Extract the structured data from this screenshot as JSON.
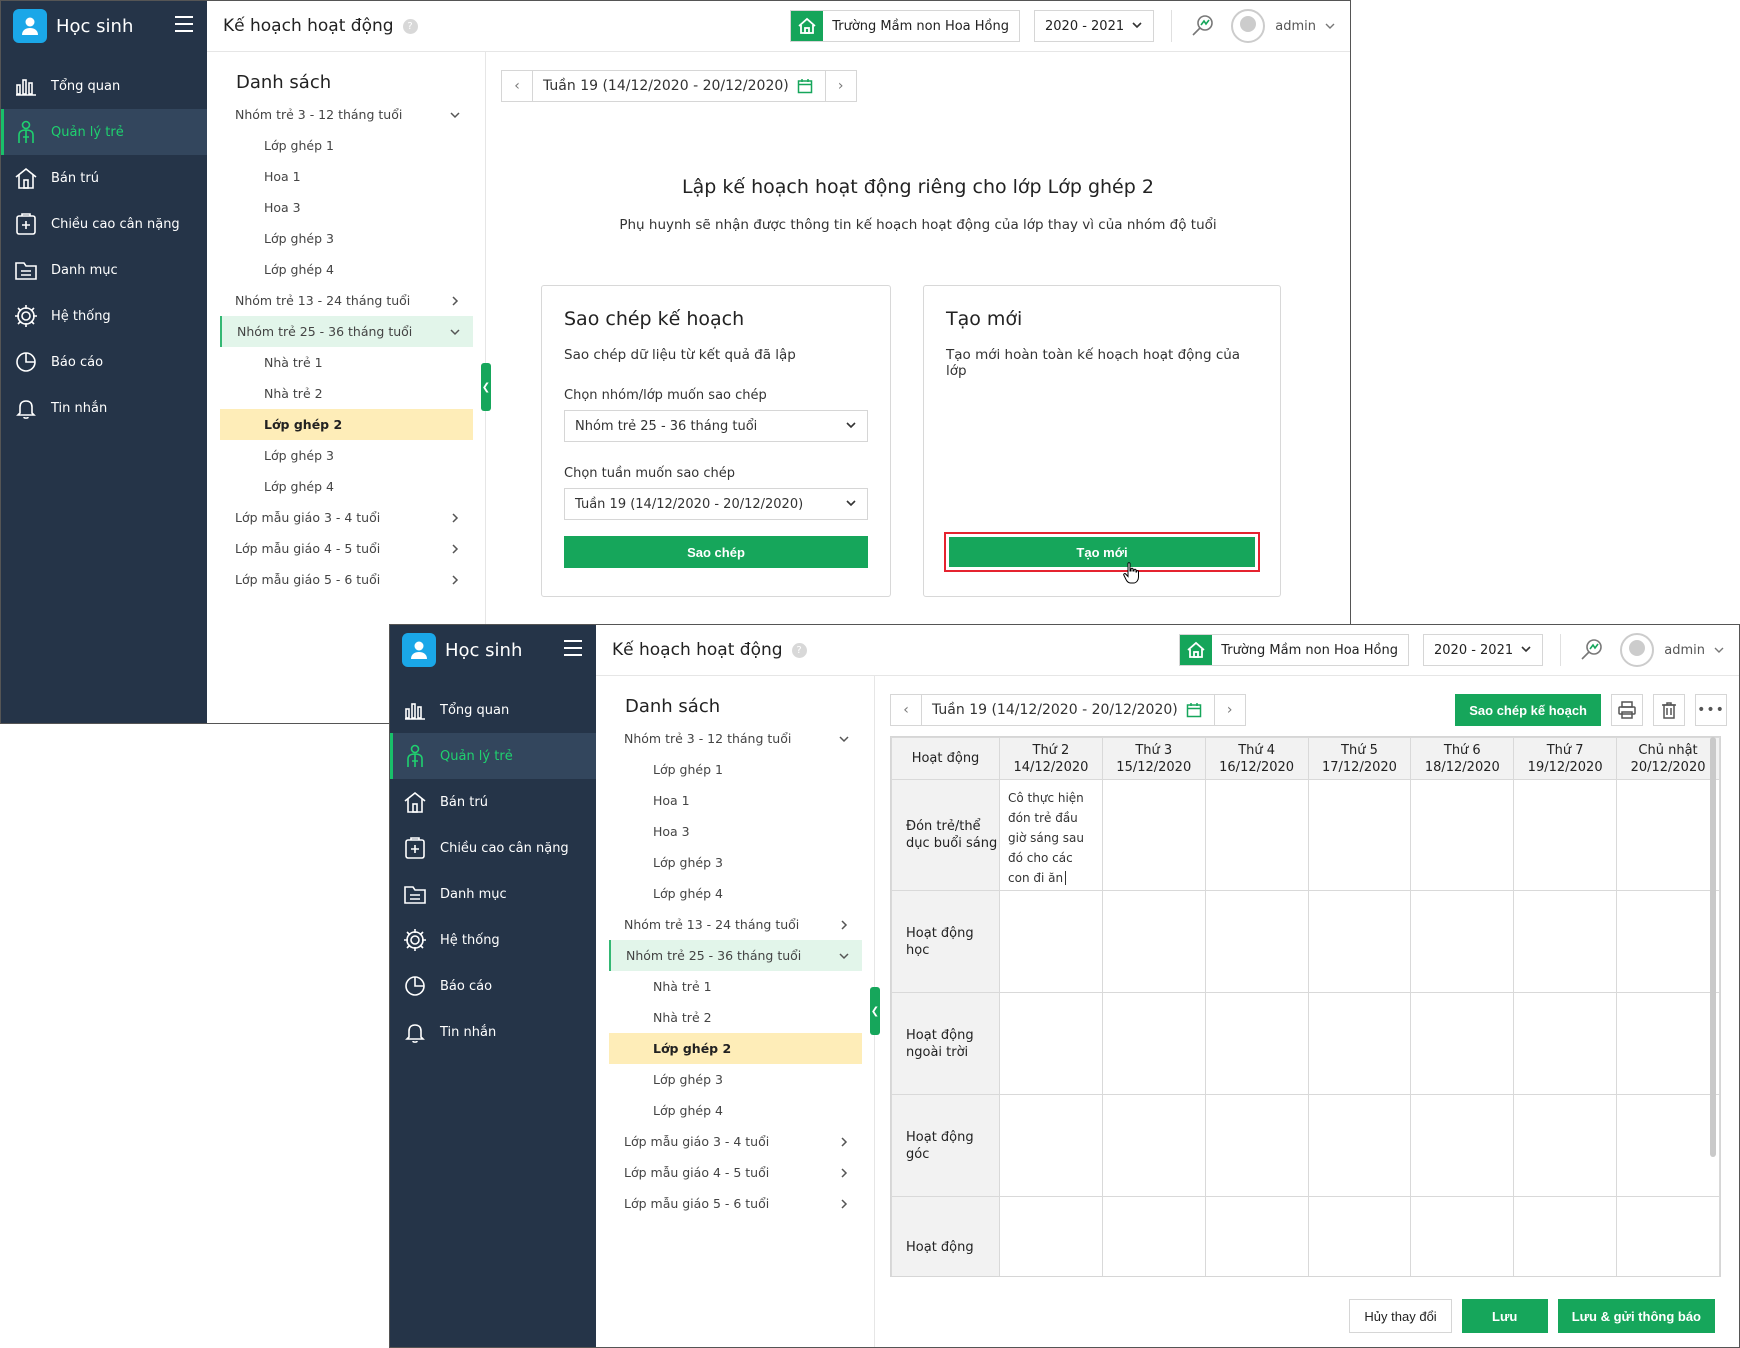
{
  "app": {
    "title": "Học sinh"
  },
  "nav": [
    "Tổng quan",
    "Quản lý trẻ",
    "Bán trú",
    "Chiều cao cân nặng",
    "Danh mục",
    "Hệ thống",
    "Báo cáo",
    "Tin nhắn"
  ],
  "nav_active": "Quản lý trẻ",
  "header": {
    "title": "Kế hoạch hoạt động",
    "help": "?",
    "school": "Trường Mầm non Hoa Hồng",
    "year": "2020 - 2021",
    "user": "admin"
  },
  "list": {
    "title": "Danh sách",
    "items": [
      {
        "label": "Nhóm trẻ 3 - 12 tháng tuổi",
        "level": 0,
        "expanded": true
      },
      {
        "label": "Lớp ghép 1",
        "level": 1
      },
      {
        "label": "Hoa 1",
        "level": 1
      },
      {
        "label": "Hoa 3",
        "level": 1
      },
      {
        "label": "Lớp ghép 3",
        "level": 1
      },
      {
        "label": "Lớp ghép 4",
        "level": 1
      },
      {
        "label": "Nhóm trẻ 13 - 24 tháng tuổi",
        "level": 0,
        "expanded": false
      },
      {
        "label": "Nhóm trẻ 25 - 36 tháng tuổi",
        "level": 0,
        "expanded": true,
        "selected": true
      },
      {
        "label": "Nhà trẻ 1",
        "level": 1
      },
      {
        "label": "Nhà trẻ 2",
        "level": 1
      },
      {
        "label": "Lớp ghép 2",
        "level": 1,
        "selected": true
      },
      {
        "label": "Lớp ghép 3",
        "level": 1
      },
      {
        "label": "Lớp ghép 4",
        "level": 1
      },
      {
        "label": "Lớp mẫu giáo 3 - 4 tuổi",
        "level": 0,
        "expanded": false
      },
      {
        "label": "Lớp mẫu giáo 4 - 5 tuổi",
        "level": 0,
        "expanded": false
      },
      {
        "label": "Lớp mẫu giáo 5 - 6 tuổi",
        "level": 0,
        "expanded": false
      }
    ]
  },
  "week": {
    "label": "Tuần 19 (14/12/2020 - 20/12/2020)"
  },
  "setup": {
    "heading": "Lập kế hoạch hoạt động riêng cho lớp Lớp ghép 2",
    "subtitle": "Phụ huynh sẽ nhận được thông tin kế hoạch hoạt động của lớp thay vì của nhóm độ tuổi",
    "copy_card": {
      "title": "Sao chép kế hoạch",
      "desc": "Sao chép dữ liệu từ kết quả đã lập",
      "group_label": "Chọn nhóm/lớp muốn sao chép",
      "group_value": "Nhóm trẻ 25 - 36 tháng tuổi",
      "week_label": "Chọn tuần muốn sao chép",
      "week_value": "Tuần 19 (14/12/2020 - 20/12/2020)",
      "button": "Sao chép"
    },
    "new_card": {
      "title": "Tạo mới",
      "desc": "Tạo mới hoàn toàn kế hoạch hoạt động của lớp",
      "button": "Tạo mới"
    }
  },
  "plan": {
    "copy_button": "Sao chép kế hoạch",
    "columns": [
      {
        "day": "Hoạt động",
        "date": ""
      },
      {
        "day": "Thứ 2",
        "date": "14/12/2020"
      },
      {
        "day": "Thứ 3",
        "date": "15/12/2020"
      },
      {
        "day": "Thứ 4",
        "date": "16/12/2020"
      },
      {
        "day": "Thứ 5",
        "date": "17/12/2020"
      },
      {
        "day": "Thứ 6",
        "date": "18/12/2020"
      },
      {
        "day": "Thứ 7",
        "date": "19/12/2020"
      },
      {
        "day": "Chủ nhật",
        "date": "20/12/2020"
      }
    ],
    "rows": [
      "Đón trẻ/thể dục buổi sáng",
      "Hoạt động học",
      "Hoạt động ngoài trời",
      "Hoạt động góc",
      "Hoạt động"
    ],
    "cell_text": "Cô thực hiện đón trẻ đầu giờ sáng sau đó cho các con đi ăn",
    "footer": {
      "cancel": "Hủy thay đổi",
      "save": "Lưu",
      "save_notify": "Lưu & gửi thông báo"
    }
  },
  "colors": {
    "sidebar": "#253448",
    "accent": "#16a65b",
    "highlight": "#e5232f",
    "selected_class": "#feedb8",
    "selected_group": "#e2f5ea"
  }
}
